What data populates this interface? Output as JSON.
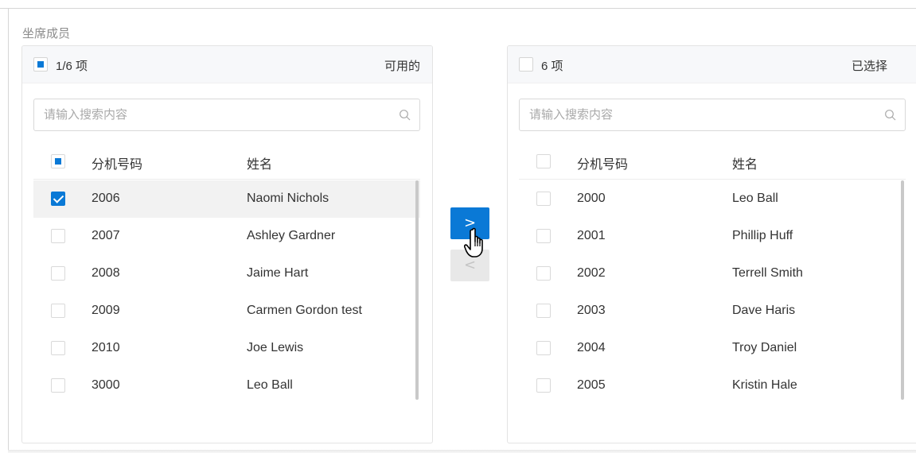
{
  "section": {
    "label": "坐席成员"
  },
  "colors": {
    "accent": "#0a79d6",
    "header_bg": "#f7f8fa",
    "selected_row": "#f2f2f2"
  },
  "left_panel": {
    "count": "1/6 项",
    "title": "可用的",
    "select_all_state": "indeterminate",
    "search_placeholder": "请输入搜索内容",
    "columns": {
      "ext": "分机号码",
      "name": "姓名"
    },
    "rows": [
      {
        "ext": "2006",
        "name": "Naomi Nichols",
        "checked": true
      },
      {
        "ext": "2007",
        "name": "Ashley Gardner",
        "checked": false
      },
      {
        "ext": "2008",
        "name": "Jaime Hart",
        "checked": false
      },
      {
        "ext": "2009",
        "name": "Carmen Gordon test",
        "checked": false
      },
      {
        "ext": "2010",
        "name": "Joe Lewis",
        "checked": false
      },
      {
        "ext": "3000",
        "name": "Leo Ball",
        "checked": false
      }
    ]
  },
  "right_panel": {
    "count": "6 项",
    "title": "已选择",
    "select_all_state": "unchecked",
    "search_placeholder": "请输入搜索内容",
    "columns": {
      "ext": "分机号码",
      "name": "姓名"
    },
    "rows": [
      {
        "ext": "2000",
        "name": "Leo Ball",
        "checked": false
      },
      {
        "ext": "2001",
        "name": "Phillip Huff",
        "checked": false
      },
      {
        "ext": "2002",
        "name": "Terrell Smith",
        "checked": false
      },
      {
        "ext": "2003",
        "name": "Dave Haris",
        "checked": false
      },
      {
        "ext": "2004",
        "name": "Troy Daniel",
        "checked": false
      },
      {
        "ext": "2005",
        "name": "Kristin Hale",
        "checked": false
      }
    ]
  },
  "transfer": {
    "move_right_label": ">",
    "move_left_label": "<",
    "move_right_enabled": true,
    "move_left_enabled": false
  },
  "icons": {
    "search": "search-icon",
    "cursor": "hand-pointer-icon"
  }
}
